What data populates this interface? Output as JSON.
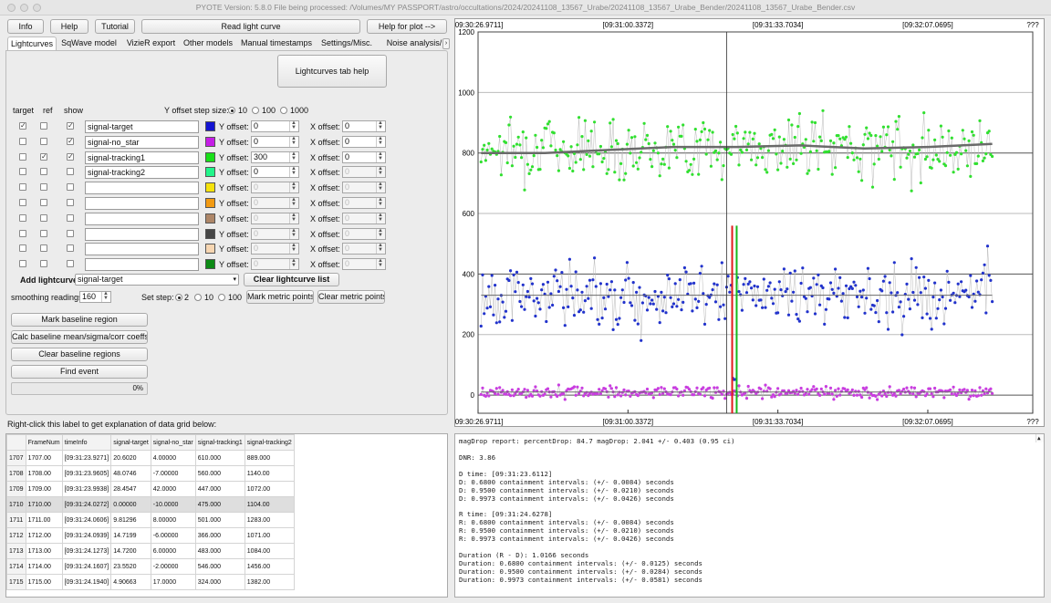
{
  "window": {
    "title": "PYOTE Version: 5.8.0  File being processed: /Volumes/MY PASSPORT/astro/occultations/2024/20241108_13567_Urabe/20241108_13567_Urabe_Bender/20241108_13567_Urabe_Bender.csv"
  },
  "toolbar": {
    "info": "Info",
    "help": "Help",
    "tutorial": "Tutorial",
    "read": "Read light curve",
    "help_plot": "Help for plot -->"
  },
  "tabs": [
    "Lightcurves",
    "SqWave model",
    "VizieR export",
    "Other models",
    "Manual timestamps",
    "Settings/Misc.",
    "Noise analysis/"
  ],
  "lc": {
    "help_button": "Lightcurves tab help",
    "col_target": "target",
    "col_ref": "ref",
    "col_show": "show",
    "y_step_label": "Y offset step size:",
    "y_step_options": [
      "10",
      "100",
      "1000"
    ],
    "y_offset_label": "Y offset:",
    "x_offset_label": "X offset:",
    "rows": [
      {
        "target": true,
        "ref": false,
        "show": true,
        "name": "signal-target",
        "color": "#1414d2",
        "y": "0",
        "x": "0",
        "enabled": true
      },
      {
        "target": false,
        "ref": false,
        "show": true,
        "name": "signal-no_star",
        "color": "#c51ee6",
        "y": "0",
        "x": "0",
        "enabled": true
      },
      {
        "target": false,
        "ref": true,
        "show": true,
        "name": "signal-tracking1",
        "color": "#19e019",
        "y": "300",
        "x": "0",
        "enabled": true
      },
      {
        "target": false,
        "ref": false,
        "show": false,
        "name": "signal-tracking2",
        "color": "#22f58a",
        "y": "0",
        "x": "0",
        "enabled": true
      },
      {
        "target": false,
        "ref": false,
        "show": false,
        "name": "",
        "color": "#f5e20c",
        "y": "0",
        "x": "0",
        "enabled": false
      },
      {
        "target": false,
        "ref": false,
        "show": false,
        "name": "",
        "color": "#f29a12",
        "y": "0",
        "x": "0",
        "enabled": false
      },
      {
        "target": false,
        "ref": false,
        "show": false,
        "name": "",
        "color": "#ad8668",
        "y": "0",
        "x": "0",
        "enabled": false
      },
      {
        "target": false,
        "ref": false,
        "show": false,
        "name": "",
        "color": "#454545",
        "y": "0",
        "x": "0",
        "enabled": false
      },
      {
        "target": false,
        "ref": false,
        "show": false,
        "name": "",
        "color": "#f7d6b2",
        "y": "0",
        "x": "0",
        "enabled": false
      },
      {
        "target": false,
        "ref": false,
        "show": false,
        "name": "",
        "color": "#0c8a14",
        "y": "0",
        "x": "0",
        "enabled": false
      }
    ],
    "add_label": "Add lightcurve",
    "add_value": "signal-target",
    "clear_list": "Clear lightcurve list",
    "smoothing_label": "smoothing readings",
    "smoothing_value": "160",
    "set_step_label": "Set step:",
    "set_step_options": [
      "2",
      "10",
      "100"
    ],
    "mark_metric": "Mark metric points",
    "clear_metric": "Clear metric points",
    "mark_baseline": "Mark baseline region",
    "calc_baseline": "Calc baseline mean/sigma/corr coeffs",
    "clear_baseline": "Clear baseline regions",
    "find_event": "Find event",
    "progress": "0%"
  },
  "grid": {
    "label": "Right-click this label to get explanation of data grid below:",
    "headers": [
      "FrameNum",
      "timeInfo",
      "signal-target",
      "signal-no_star",
      "signal-tracking1",
      "signal-tracking2"
    ],
    "rows": [
      [
        "1707",
        "1707.00",
        "[09:31:23.9271]",
        "20.6020",
        "4.00000",
        "610.000",
        "889.000"
      ],
      [
        "1708",
        "1708.00",
        "[09:31:23.9605]",
        "48.0746",
        "-7.00000",
        "560.000",
        "1140.00"
      ],
      [
        "1709",
        "1709.00",
        "[09:31:23.9938]",
        "28.4547",
        "42.0000",
        "447.000",
        "1072.00"
      ],
      [
        "1710",
        "1710.00",
        "[09:31:24.0272]",
        "0.00000",
        "-10.0000",
        "475.000",
        "1104.00"
      ],
      [
        "1711",
        "1711.00",
        "[09:31:24.0606]",
        "9.81296",
        "8.00000",
        "501.000",
        "1283.00"
      ],
      [
        "1712",
        "1712.00",
        "[09:31:24.0939]",
        "14.7199",
        "-6.00000",
        "366.000",
        "1071.00"
      ],
      [
        "1713",
        "1713.00",
        "[09:31:24.1273]",
        "14.7200",
        "6.00000",
        "483.000",
        "1084.00"
      ],
      [
        "1714",
        "1714.00",
        "[09:31:24.1607]",
        "23.5520",
        "-2.00000",
        "546.000",
        "1456.00"
      ],
      [
        "1715",
        "1715.00",
        "[09:31:24.1940]",
        "4.90663",
        "17.0000",
        "324.000",
        "1382.00"
      ]
    ]
  },
  "report": [
    "magDrop report: percentDrop: 84.7 magDrop: 2.041 +/- 0.403 (0.95 ci)",
    "",
    "DNR: 3.86",
    "",
    "D time: [09:31:23.6112]",
    "D: 0.6800 containment intervals: (+/- 0.0084) seconds",
    "D: 0.9500 containment intervals: (+/- 0.0210) seconds",
    "D: 0.9973 containment intervals: (+/- 0.0426) seconds",
    "",
    "R time: [09:31:24.6278]",
    "R: 0.6800 containment intervals: (+/- 0.0084) seconds",
    "R: 0.9500 containment intervals: (+/- 0.0210) seconds",
    "R: 0.9973 containment intervals: (+/- 0.0426) seconds",
    "",
    "Duration (R - D): 1.0166 seconds",
    "Duration: 0.6800 containment intervals: (+/- 0.0125) seconds",
    "Duration: 0.9500 containment intervals: (+/- 0.0284) seconds",
    "Duration: 0.9973 containment intervals: (+/- 0.0581) seconds"
  ],
  "chart_data": {
    "type": "scatter",
    "x_tick_labels": [
      "[09:30:26.9711]",
      "[09:31:00.3372]",
      "[09:31:33.7034]",
      "[09:32:07.0695]",
      "???"
    ],
    "yticks": [
      0,
      200,
      400,
      600,
      800,
      1000,
      1200
    ],
    "ylim": [
      -60,
      1200
    ],
    "x_frames": [
      0,
      3450
    ],
    "x_tick_frames": [
      0,
      1000,
      2000,
      3000,
      3700
    ],
    "event_frames": [
      1695,
      1725
    ],
    "grid": true,
    "series": [
      {
        "color": "#31e030",
        "baseline": 820,
        "spread": 70,
        "smooth": [
          800,
          800,
          810,
          820,
          820,
          825,
          815,
          820,
          830
        ]
      },
      {
        "color": "#2233cc",
        "baseline": 330,
        "spread": 75,
        "dropTo": 50,
        "smooth": [
          330,
          330,
          330,
          330,
          330,
          330,
          330,
          330,
          330
        ]
      },
      {
        "color": "#c93de0",
        "baseline": 10,
        "spread": 14,
        "smooth": [
          10,
          10,
          10,
          10,
          10,
          10,
          10,
          10,
          10
        ]
      }
    ]
  }
}
